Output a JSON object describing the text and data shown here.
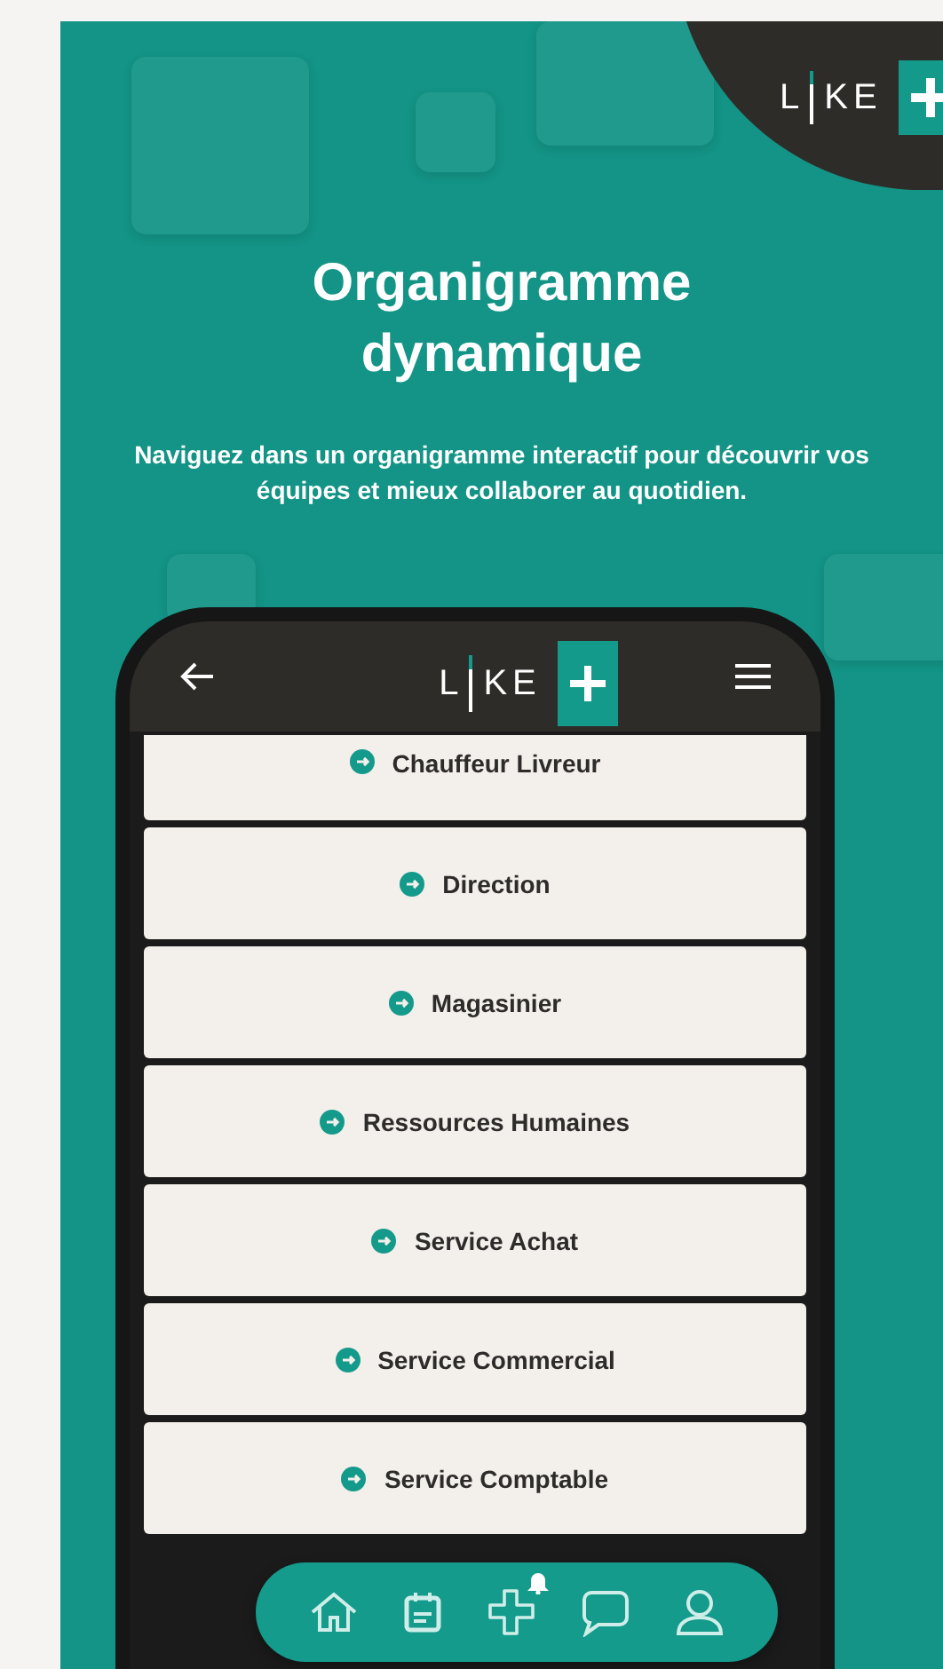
{
  "hero": {
    "title": "Organigramme dynamique",
    "subtitle": "Naviguez dans un organigramme interactif pour découvrir vos équipes et mieux collaborer au quotidien."
  },
  "logo": {
    "left": "L",
    "right": "KE"
  },
  "phone": {
    "logo": {
      "left": "L",
      "right": "KE"
    },
    "departments": [
      {
        "label": "Chauffeur Livreur"
      },
      {
        "label": "Direction"
      },
      {
        "label": "Magasinier"
      },
      {
        "label": "Ressources Humaines"
      },
      {
        "label": "Service Achat"
      },
      {
        "label": "Service Commercial"
      },
      {
        "label": "Service Comptable"
      }
    ],
    "nav": [
      {
        "kind": "home",
        "badge": false
      },
      {
        "kind": "calendar",
        "badge": false
      },
      {
        "kind": "plus",
        "badge": true
      },
      {
        "kind": "chat",
        "badge": false
      },
      {
        "kind": "profile",
        "badge": false
      }
    ]
  }
}
